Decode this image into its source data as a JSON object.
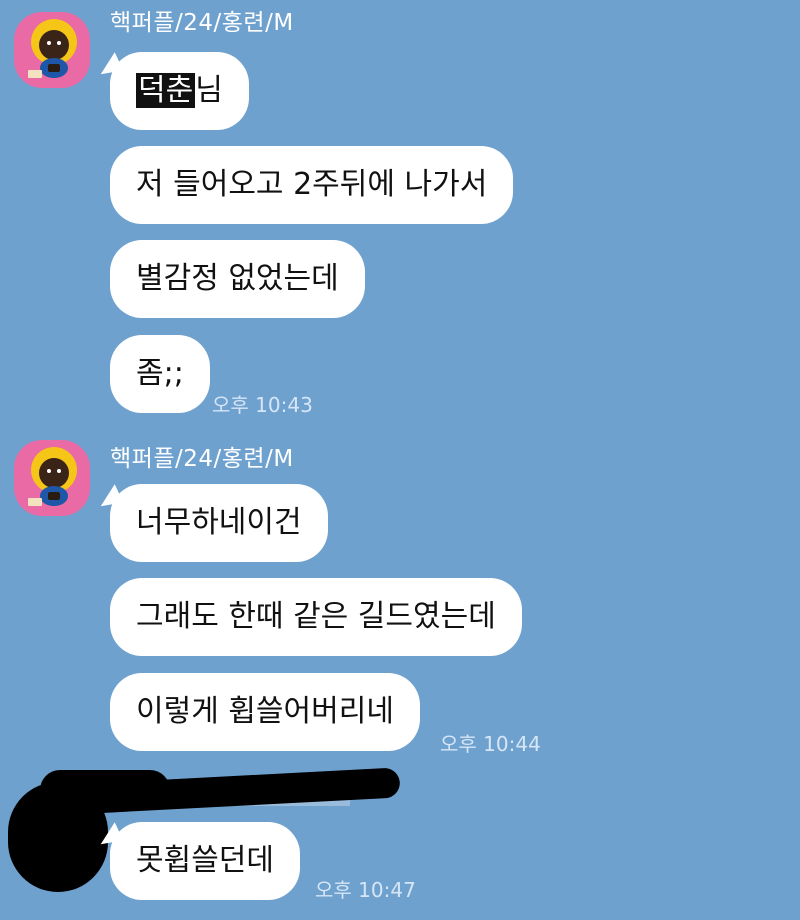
{
  "groups": [
    {
      "sender": "핵퍼플/24/홍련/M",
      "messages": [
        {
          "highlight": "덕춘",
          "text": "님"
        },
        {
          "text": "저 들어오고 2주뒤에 나가서"
        },
        {
          "text": "별감정 없었는데"
        },
        {
          "text": "좀;;"
        }
      ],
      "time": "오후 10:43"
    },
    {
      "sender": "핵퍼플/24/홍련/M",
      "messages": [
        {
          "text": "너무하네이건"
        },
        {
          "text": "그래도 한때 같은 길드였는데"
        },
        {
          "text": "이렇게 휩쓸어버리네"
        }
      ],
      "time": "오후 10:44"
    },
    {
      "sender": "",
      "messages": [
        {
          "text": "못휩쓸던데"
        }
      ],
      "time": "오후 10:47"
    }
  ],
  "colors": {
    "background": "#6fa1cf",
    "bubble": "#ffffff",
    "avatar_bg": "#e96aa4",
    "avatar_face": "#3a2418",
    "avatar_hair": "#f5c518",
    "avatar_body": "#1e56a8"
  },
  "icons": {
    "avatar": "character-avatar-icon"
  }
}
